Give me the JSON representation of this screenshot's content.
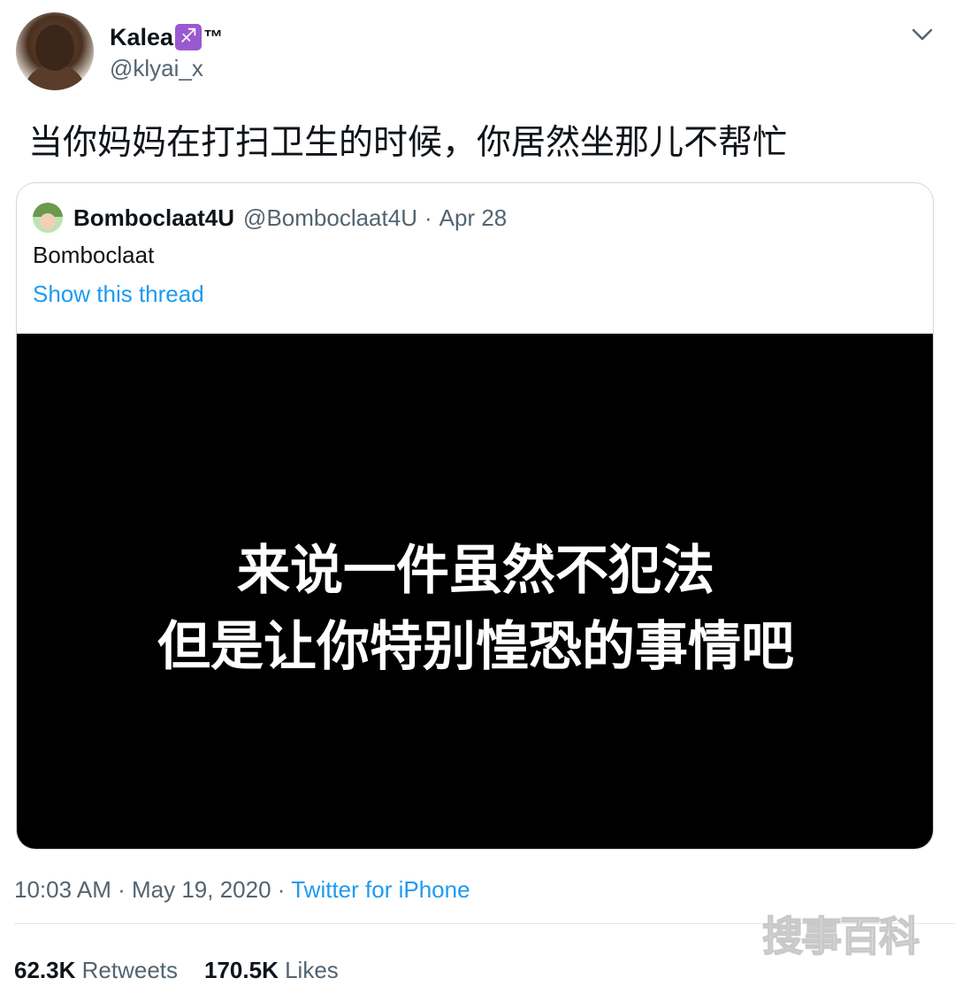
{
  "header": {
    "display_name": "Kalea",
    "zodiac_badge": "♐",
    "trademark": "™",
    "handle": "@klyai_x",
    "more_icon": "chevron-down-icon"
  },
  "tweet": {
    "text": "当你妈妈在打扫卫生的时候，你居然坐那儿不帮忙"
  },
  "quoted_tweet": {
    "name": "Bomboclaat4U",
    "handle": "@Bomboclaat4U",
    "separator": "·",
    "date": "Apr 28",
    "text": "Bomboclaat",
    "thread_link": "Show this thread",
    "video_subtitle_line1": "来说一件虽然不犯法",
    "video_subtitle_line2": "但是让你特别惶恐的事情吧"
  },
  "meta": {
    "time": "10:03 AM",
    "separator": "·",
    "date": "May 19, 2020",
    "source": "Twitter for iPhone"
  },
  "stats": {
    "retweets_count": "62.3K",
    "retweets_label": "Retweets",
    "likes_count": "170.5K",
    "likes_label": "Likes"
  },
  "watermark": "搜事百科",
  "colors": {
    "link": "#1d9bf0",
    "secondary_text": "#536471",
    "primary_text": "#0f1419",
    "border": "#cfd9de"
  }
}
